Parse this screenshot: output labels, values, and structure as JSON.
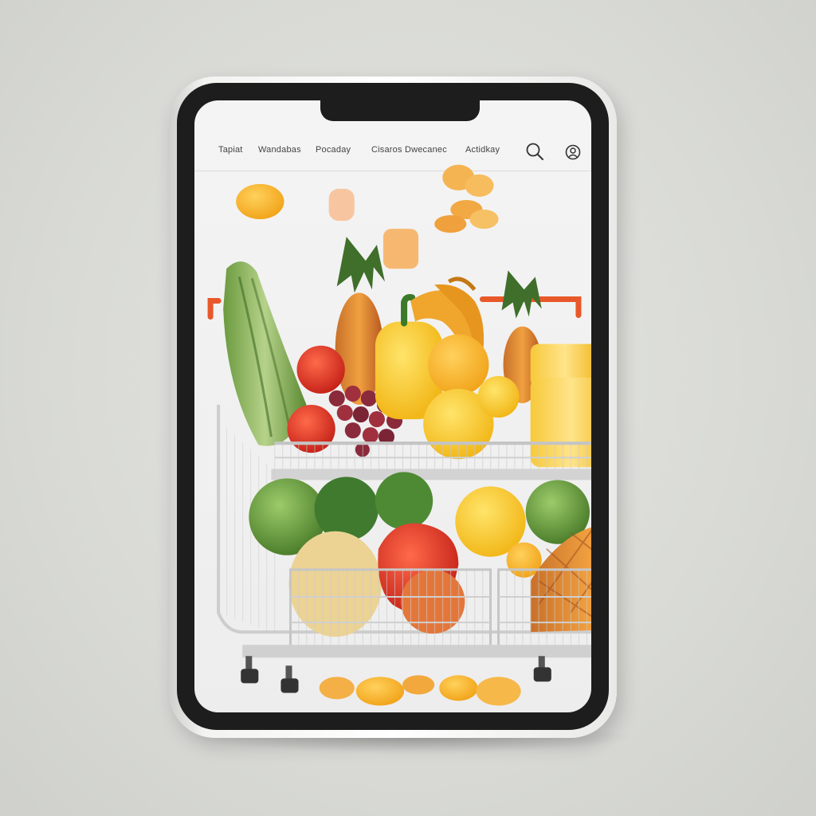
{
  "nav": {
    "items": [
      {
        "label": "Tapiat"
      },
      {
        "label": "Wandabas"
      },
      {
        "label": "Pocaday"
      },
      {
        "label": "Cisaros Dwecanec"
      },
      {
        "label": "Actidkay"
      }
    ],
    "icons": [
      "search-icon",
      "account-icon"
    ]
  },
  "colors": {
    "accent": "#e8582a",
    "bezel": "#1d1d1d",
    "background": "#dcddd9"
  }
}
